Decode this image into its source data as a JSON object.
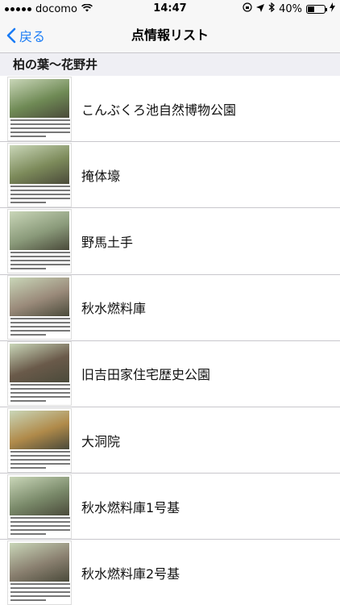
{
  "status_bar": {
    "carrier": "docomo",
    "time": "14:47",
    "battery_percent": "40%",
    "battery_level": 0.4
  },
  "nav": {
    "back_label": "戻る",
    "title": "点情報リスト"
  },
  "section": {
    "title": "柏の葉〜花野井"
  },
  "items": [
    {
      "label": "こんぶくろ池自然博物公園",
      "thumb_color": "#6f8a55"
    },
    {
      "label": "掩体壕",
      "thumb_color": "#7c8a5a"
    },
    {
      "label": "野馬土手",
      "thumb_color": "#8a9a7a"
    },
    {
      "label": "秋水燃料庫",
      "thumb_color": "#9a8a7a"
    },
    {
      "label": "旧吉田家住宅歴史公園",
      "thumb_color": "#6a5a4a"
    },
    {
      "label": "大洞院",
      "thumb_color": "#b08a4a"
    },
    {
      "label": "秋水燃料庫1号基",
      "thumb_color": "#7a8a6a"
    },
    {
      "label": "秋水燃料庫2号基",
      "thumb_color": "#8a8070"
    }
  ]
}
